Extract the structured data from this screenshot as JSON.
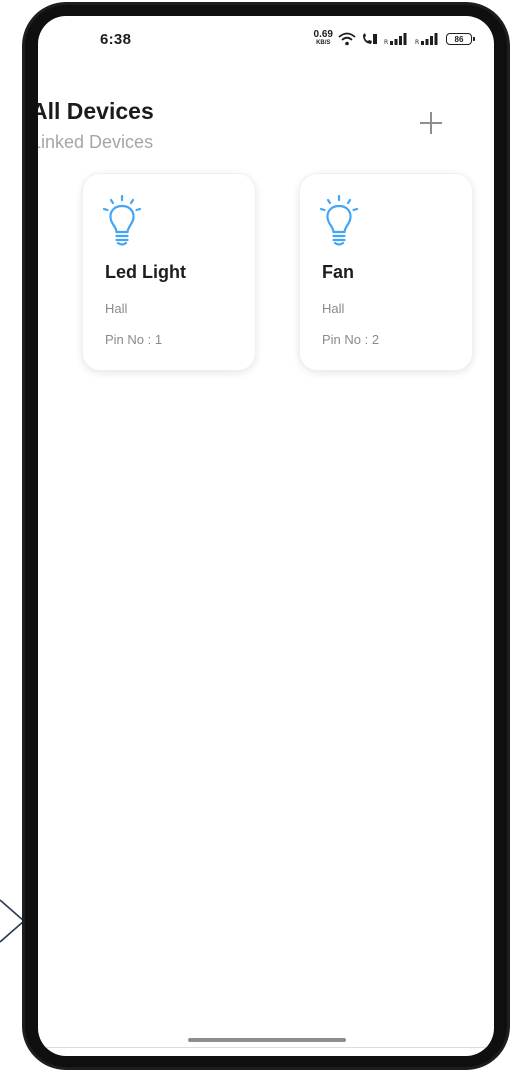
{
  "status_bar": {
    "time": "6:38",
    "net_speed_value": "0.69",
    "net_speed_unit": "KB/S",
    "battery": "86",
    "icons": [
      "wifi-icon",
      "volte-call-icon",
      "signal-icon-1",
      "signal-icon-2",
      "battery-icon"
    ]
  },
  "header": {
    "title": "All Devices",
    "subtitle": "Linked Devices",
    "add_icon": "plus-icon"
  },
  "devices": [
    {
      "name": "Led Light",
      "room": "Hall",
      "pin": "Pin No : 1",
      "icon": "bulb-icon"
    },
    {
      "name": "Fan",
      "room": "Hall",
      "pin": "Pin No : 2",
      "icon": "bulb-icon"
    }
  ],
  "colors": {
    "accent": "#42a5f5",
    "title_text": "#1b1b1b",
    "muted_text": "#8a8a8a",
    "subtitle_text": "#a6a6a6",
    "frame": "#1e1e1e"
  }
}
